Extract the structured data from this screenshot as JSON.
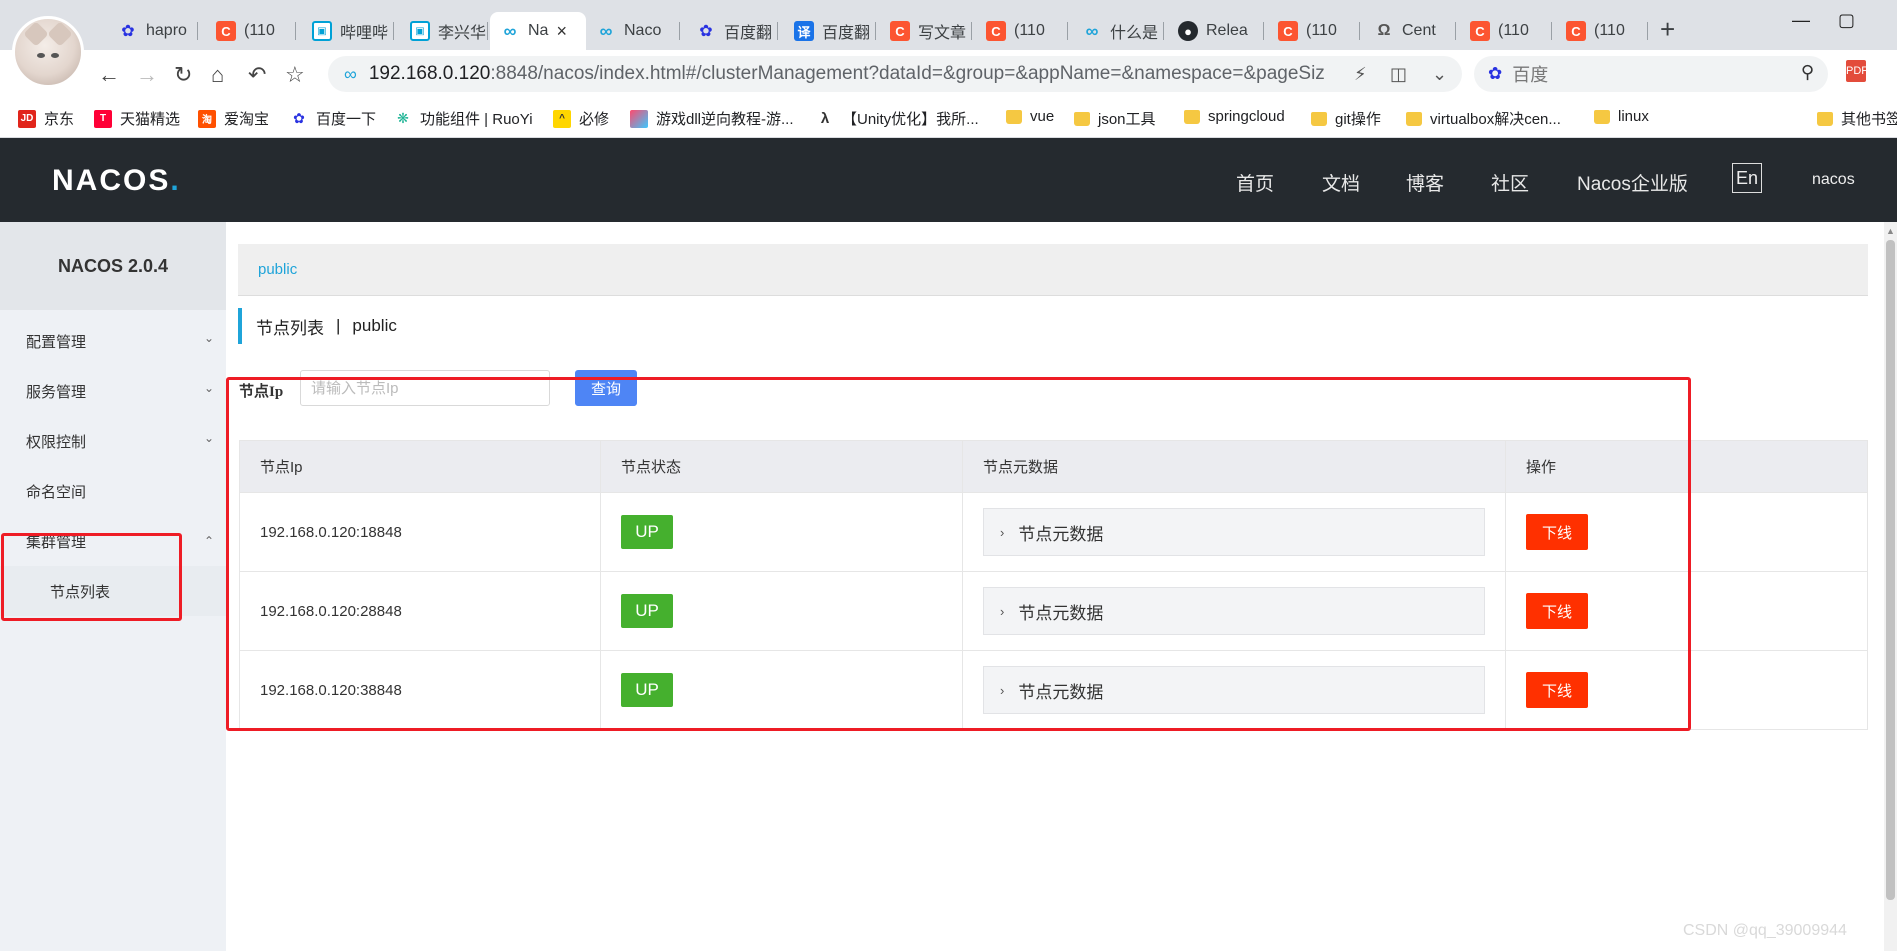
{
  "browser": {
    "tabs": [
      {
        "label": "hapro",
        "icon": "baidu"
      },
      {
        "label": "(110",
        "icon": "csdn"
      },
      {
        "label": "哔哩哔",
        "icon": "bili"
      },
      {
        "label": "李兴华",
        "icon": "bili"
      },
      {
        "label": "Na",
        "icon": "nacos",
        "active": true
      },
      {
        "label": "Naco",
        "icon": "nacos"
      },
      {
        "label": "百度翻",
        "icon": "baidu"
      },
      {
        "label": "百度翻",
        "icon": "yi"
      },
      {
        "label": "写文章",
        "icon": "csdn"
      },
      {
        "label": "(110",
        "icon": "csdn"
      },
      {
        "label": "什么是",
        "icon": "nacos"
      },
      {
        "label": "Relea",
        "icon": "github"
      },
      {
        "label": "(110",
        "icon": "csdn"
      },
      {
        "label": "Cent",
        "icon": "centos"
      },
      {
        "label": "(110",
        "icon": "csdn"
      },
      {
        "label": "(110",
        "icon": "csdn"
      }
    ],
    "url_host": "192.168.0.120",
    "url_rest": ":8848/nacos/index.html#/clusterManagement?dataId=&group=&appName=&namespace=&pageSiz",
    "search_engine_placeholder": "百度",
    "bookmarks": [
      {
        "label": "京东",
        "icon": "jd"
      },
      {
        "label": "天猫精选",
        "icon": "tmall"
      },
      {
        "label": "爱淘宝",
        "icon": "taobao"
      },
      {
        "label": "百度一下",
        "icon": "baidu"
      },
      {
        "label": "功能组件 | RuoYi",
        "icon": "ruoyi"
      },
      {
        "label": "必修",
        "icon": "bixiu"
      },
      {
        "label": "游戏dll逆向教程-游...",
        "icon": "game"
      },
      {
        "label": "【Unity优化】我所...",
        "icon": "unity"
      },
      {
        "label": "vue",
        "icon": "folder"
      },
      {
        "label": "json工具",
        "icon": "folder"
      },
      {
        "label": "springcloud",
        "icon": "folder"
      },
      {
        "label": "git操作",
        "icon": "folder"
      },
      {
        "label": "virtualbox解决cen...",
        "icon": "folder"
      },
      {
        "label": "linux",
        "icon": "folder"
      },
      {
        "label": "其他书签",
        "icon": "folder"
      }
    ]
  },
  "header": {
    "logo_main": "NACOS",
    "logo_dot": ".",
    "menu": [
      "首页",
      "文档",
      "博客",
      "社区",
      "Nacos企业版"
    ],
    "lang_button": "En",
    "user": "nacos"
  },
  "sidebar": {
    "version": "NACOS 2.0.4",
    "items": [
      {
        "label": "配置管理",
        "chevron": "down"
      },
      {
        "label": "服务管理",
        "chevron": "down"
      },
      {
        "label": "权限控制",
        "chevron": "down"
      },
      {
        "label": "命名空间"
      },
      {
        "label": "集群管理",
        "chevron": "up",
        "expanded": true
      }
    ],
    "sub_items": [
      "节点列表"
    ]
  },
  "main": {
    "namespace": "public",
    "title": "节点列表",
    "title_separator": "|",
    "title_namespace": "public",
    "search_label": "节点Ip",
    "search_placeholder": "请输入节点Ip",
    "search_value": "",
    "search_button": "查询",
    "columns": [
      "节点Ip",
      "节点状态",
      "节点元数据",
      "操作"
    ],
    "rows": [
      {
        "ip": "192.168.0.120:18848",
        "status": "UP",
        "metadata": "节点元数据",
        "action": "下线"
      },
      {
        "ip": "192.168.0.120:28848",
        "status": "UP",
        "metadata": "节点元数据",
        "action": "下线"
      },
      {
        "ip": "192.168.0.120:38848",
        "status": "UP",
        "metadata": "节点元数据",
        "action": "下线"
      }
    ]
  },
  "watermark": "CSDN @qq_39009944",
  "colors": {
    "header_bg": "#252a2f",
    "accent": "#1fa4d9",
    "status_up": "#45b02e",
    "offline_button": "#ff3000",
    "query_button": "#4e85f5",
    "annotation": "#ee1c25"
  }
}
